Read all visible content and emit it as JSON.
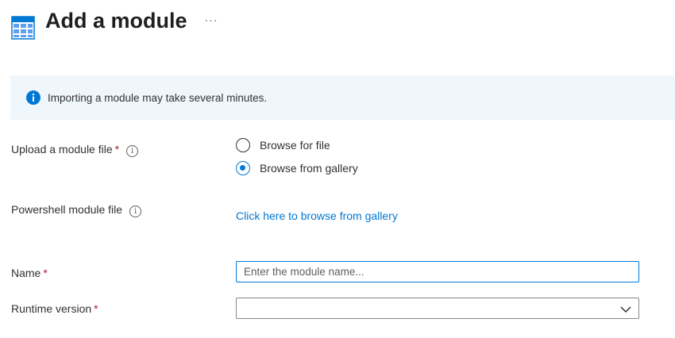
{
  "header": {
    "title": "Add a module",
    "more_label": "···",
    "icon": "module-grid-icon"
  },
  "info_bar": {
    "icon": "info-icon",
    "message": "Importing a module may take several minutes."
  },
  "form": {
    "upload": {
      "label": "Upload a module file",
      "required_mark": "*",
      "help_glyph": "i",
      "options": [
        {
          "label": "Browse for file",
          "selected": false
        },
        {
          "label": "Browse from gallery",
          "selected": true
        }
      ]
    },
    "powershell": {
      "label": "Powershell module file",
      "help_glyph": "i",
      "link_text": "Click here to browse from gallery"
    },
    "name": {
      "label": "Name",
      "required_mark": "*",
      "value": "",
      "placeholder": "Enter the module name..."
    },
    "runtime": {
      "label": "Runtime version",
      "required_mark": "*",
      "selected_value": ""
    }
  },
  "colors": {
    "accent": "#0078d4",
    "required": "#a4262c",
    "info_background": "#eff6fc",
    "text": "#323130"
  }
}
